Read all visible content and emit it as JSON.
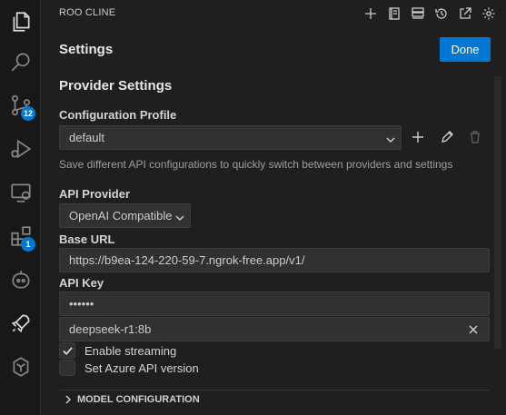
{
  "activity_bar": {
    "items": [
      {
        "icon": "files-icon"
      },
      {
        "icon": "search-icon"
      },
      {
        "icon": "source-control-icon",
        "badge": "12"
      },
      {
        "icon": "run-debug-icon"
      },
      {
        "icon": "remote-explorer-icon"
      },
      {
        "icon": "extensions-icon",
        "badge": "1"
      },
      {
        "icon": "robot-icon"
      },
      {
        "icon": "rocket-icon"
      },
      {
        "icon": "copilot-icon"
      }
    ]
  },
  "panel": {
    "title": "ROO CLINE",
    "header_icons": [
      "plus-icon",
      "notebook-icon",
      "server-icon",
      "history-icon",
      "open-external-icon",
      "gear-icon"
    ]
  },
  "settings": {
    "title": "Settings",
    "done_label": "Done",
    "provider_section": "Provider Settings",
    "config_profile_label": "Configuration Profile",
    "config_profile_value": "default",
    "config_profile_desc": "Save different API configurations to quickly switch between providers and settings",
    "api_provider_label": "API Provider",
    "api_provider_value": "OpenAI Compatible",
    "base_url_label": "Base URL",
    "base_url_value": "https://b9ea-124-220-59-7.ngrok-free.app/v1/",
    "api_key_label": "API Key",
    "api_key_value": "••••••",
    "model_value": "deepseek-r1:8b",
    "enable_streaming_label": "Enable streaming",
    "enable_streaming_checked": true,
    "azure_api_label": "Set Azure API version",
    "azure_api_checked": false,
    "model_config_label": "MODEL CONFIGURATION"
  },
  "colors": {
    "accent": "#0078d4",
    "background": "#1f1f1f",
    "activity_bar": "#181818"
  }
}
